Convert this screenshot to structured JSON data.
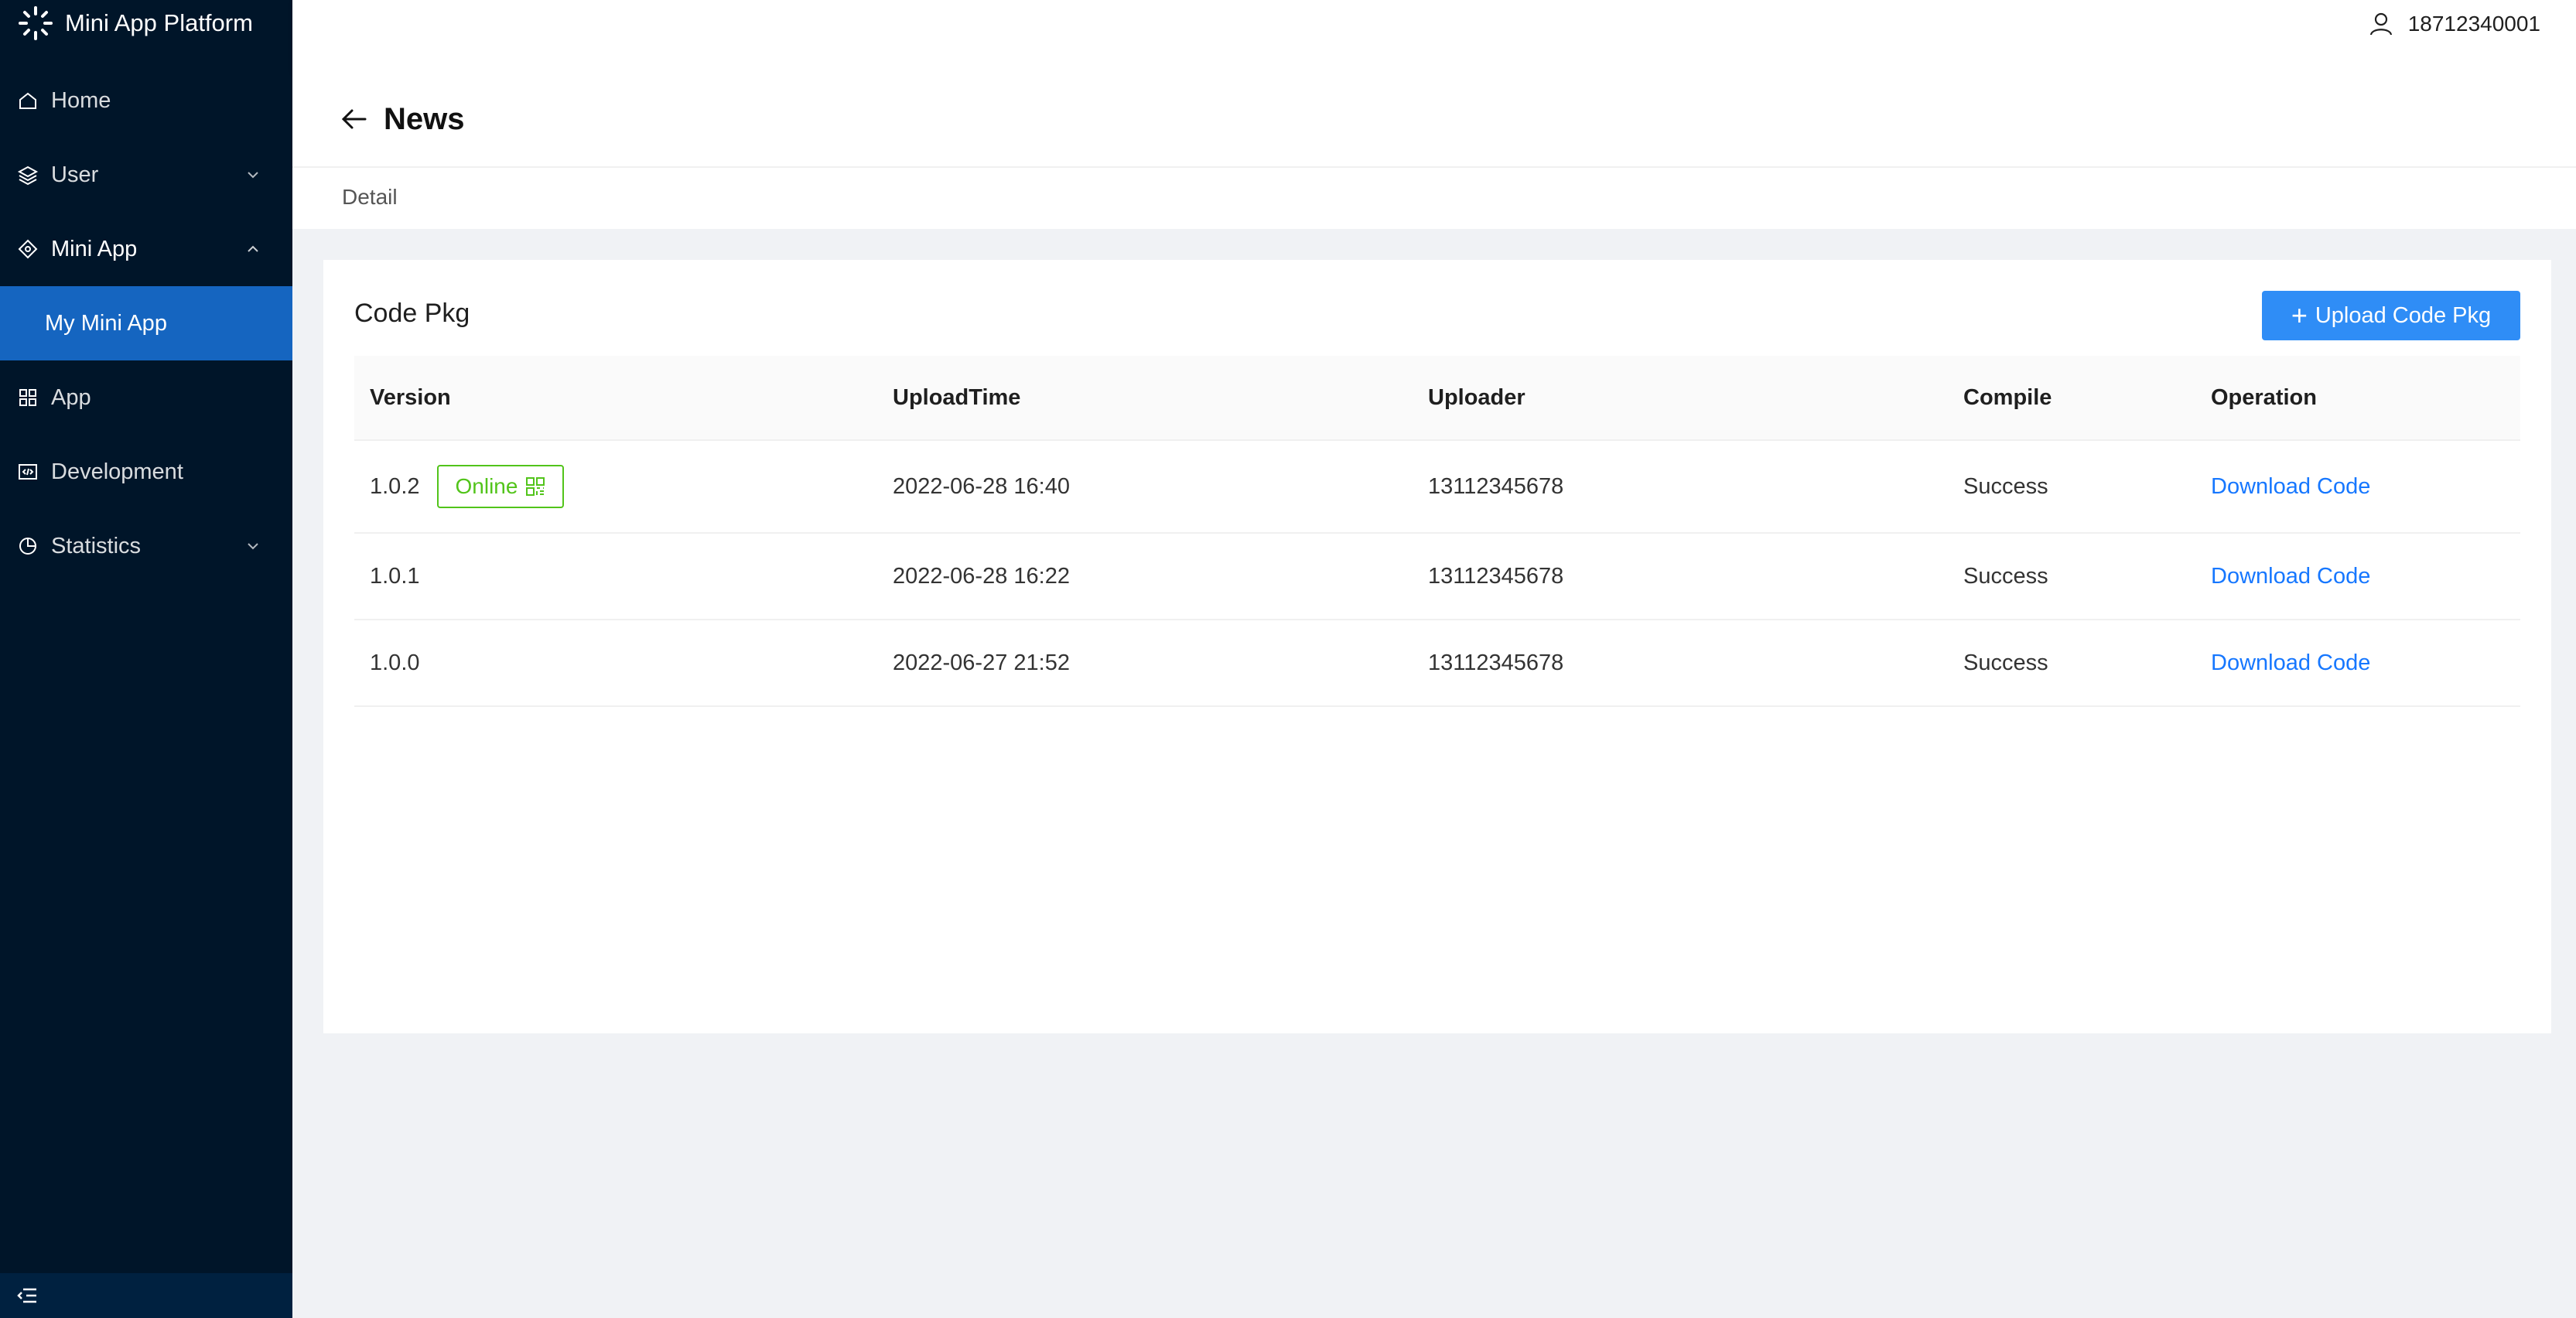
{
  "app": {
    "name": "Mini App Platform"
  },
  "sidebar": {
    "items": [
      {
        "label": "Home",
        "icon": "home-icon"
      },
      {
        "label": "User",
        "icon": "layers-icon",
        "expandable": true,
        "expanded": false
      },
      {
        "label": "Mini App",
        "icon": "diamond-icon",
        "expandable": true,
        "expanded": true,
        "children": [
          {
            "label": "My Mini App",
            "selected": true
          }
        ]
      },
      {
        "label": "App",
        "icon": "grid-icon"
      },
      {
        "label": "Development",
        "icon": "code-icon"
      },
      {
        "label": "Statistics",
        "icon": "pie-chart-icon",
        "expandable": true,
        "expanded": false
      }
    ],
    "footer_icon": "menu-fold-icon"
  },
  "header": {
    "username": "18712340001",
    "user_icon": "user-icon"
  },
  "page": {
    "title": "News",
    "breadcrumb": "Detail",
    "back_icon": "arrow-left-icon"
  },
  "code_pkg": {
    "title": "Code Pkg",
    "upload_label": "Upload Code Pkg",
    "columns": [
      "Version",
      "UploadTime",
      "Uploader",
      "Compile",
      "Operation"
    ],
    "rows": [
      {
        "version": "1.0.2",
        "tag": "Online",
        "upload_time": "2022-06-28 16:40",
        "uploader": "13112345678",
        "compile": "Success",
        "operation": "Download Code"
      },
      {
        "version": "1.0.1",
        "upload_time": "2022-06-28 16:22",
        "uploader": "13112345678",
        "compile": "Success",
        "operation": "Download Code"
      },
      {
        "version": "1.0.0",
        "upload_time": "2022-06-27 21:52",
        "uploader": "13112345678",
        "compile": "Success",
        "operation": "Download Code"
      }
    ]
  },
  "colors": {
    "sidebar_bg": "#001529",
    "selected_bg": "#1565c0",
    "primary": "#2f8df6",
    "link": "#1677ff",
    "online": "#52c41a"
  }
}
